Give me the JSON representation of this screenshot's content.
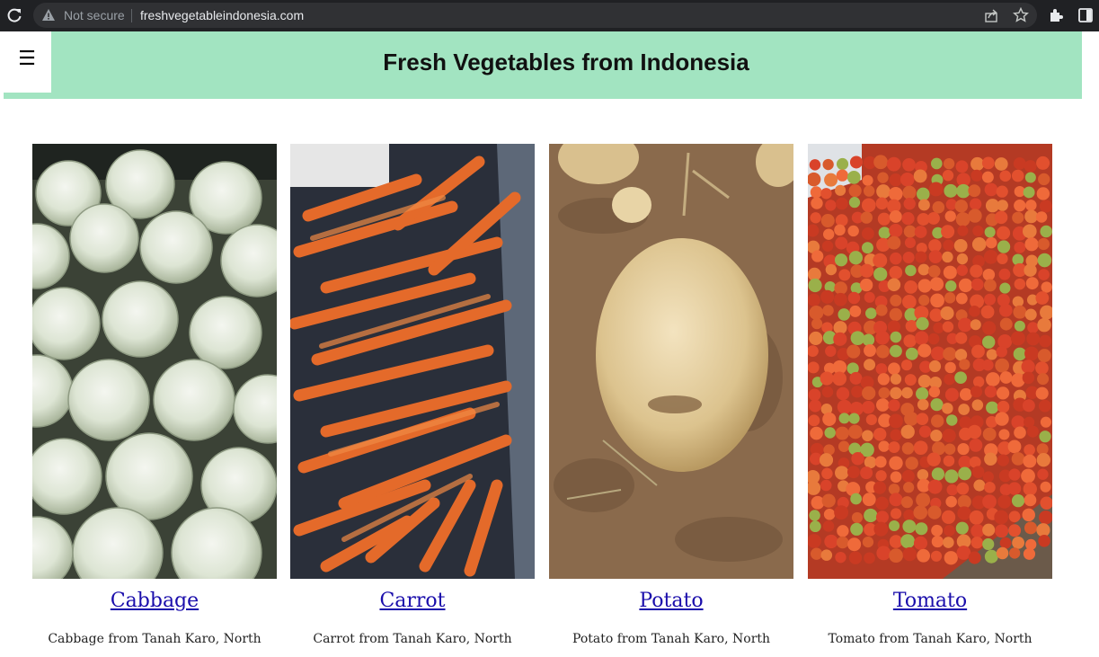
{
  "browser": {
    "security_label": "Not secure",
    "url": "freshvegetableindonesia.com"
  },
  "header": {
    "menu_icon": "hamburger-icon",
    "title": "Fresh Vegetables from Indonesia",
    "background": "#a2e4c1"
  },
  "products": [
    {
      "name": "Cabbage",
      "description": "Cabbage from Tanah Karo, North",
      "image": "cabbage-photo"
    },
    {
      "name": "Carrot",
      "description": "Carrot from Tanah Karo, North",
      "image": "carrot-photo"
    },
    {
      "name": "Potato",
      "description": "Potato from Tanah Karo, North",
      "image": "potato-photo"
    },
    {
      "name": "Tomato",
      "description": "Tomato from Tanah Karo, North",
      "image": "tomato-photo"
    }
  ],
  "colors": {
    "link": "#1a0dab",
    "chrome": "#202124"
  }
}
